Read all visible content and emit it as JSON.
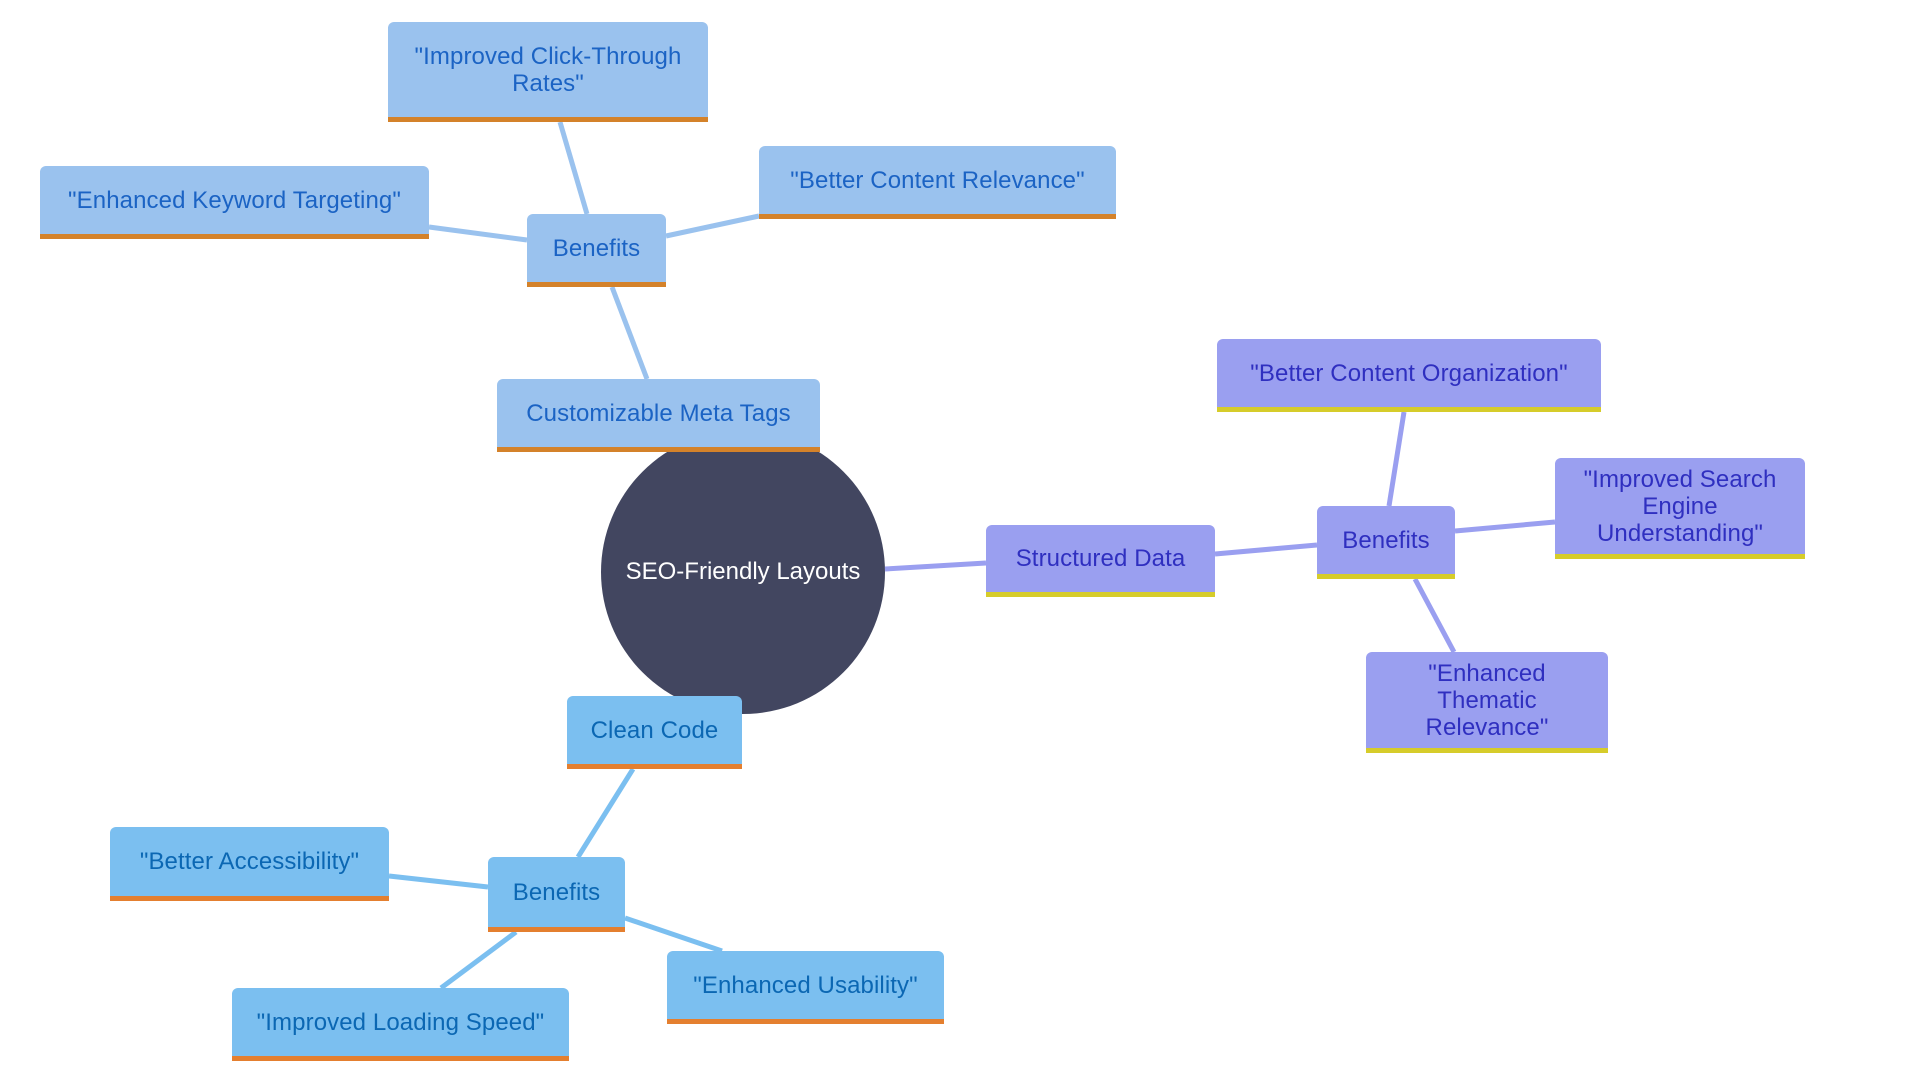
{
  "diagram": {
    "type": "mindmap",
    "root": {
      "id": "root",
      "label": "SEO-Friendly Layouts"
    },
    "colors": {
      "root_fill": "#424660",
      "root_text": "#ffffff",
      "branch_meta": {
        "fill": "#9ac2ee",
        "text": "#1b63c4",
        "underline": "#d4822a",
        "edge": "#9ac2ee"
      },
      "branch_structured": {
        "fill": "#9a9ff0",
        "text": "#2f2fc0",
        "underline": "#d6cc2a",
        "edge": "#9a9ff0"
      },
      "branch_clean": {
        "fill": "#7bbff0",
        "text": "#0b67b3",
        "underline": "#e47f2f",
        "edge": "#7bbff0"
      }
    },
    "nodes": [
      {
        "id": "meta",
        "label": "Customizable Meta Tags",
        "parent": "root",
        "branch": "top"
      },
      {
        "id": "meta-benefits",
        "label": "Benefits",
        "parent": "meta",
        "branch": "top"
      },
      {
        "id": "meta-b1",
        "label": "\"Improved Click-Through Rates\"",
        "lines": [
          "\"Improved Click-Through",
          "Rates\""
        ],
        "parent": "meta-benefits",
        "branch": "top"
      },
      {
        "id": "meta-b2",
        "label": "\"Enhanced Keyword Targeting\"",
        "lines": [
          "\"Enhanced Keyword Targeting\""
        ],
        "parent": "meta-benefits",
        "branch": "top"
      },
      {
        "id": "meta-b3",
        "label": "\"Better Content Relevance\"",
        "lines": [
          "\"Better Content Relevance\""
        ],
        "parent": "meta-benefits",
        "branch": "top"
      },
      {
        "id": "struct",
        "label": "Structured Data",
        "parent": "root",
        "branch": "right"
      },
      {
        "id": "struct-benefits",
        "label": "Benefits",
        "parent": "struct",
        "branch": "right"
      },
      {
        "id": "struct-b1",
        "label": "\"Better Content Organization\"",
        "lines": [
          "\"Better Content Organization\""
        ],
        "parent": "struct-benefits",
        "branch": "right"
      },
      {
        "id": "struct-b2",
        "label": "\"Improved Search Engine Understanding\"",
        "lines": [
          "\"Improved Search Engine",
          "Understanding\""
        ],
        "parent": "struct-benefits",
        "branch": "right"
      },
      {
        "id": "struct-b3",
        "label": "\"Enhanced Thematic Relevance\"",
        "lines": [
          "\"Enhanced Thematic",
          "Relevance\""
        ],
        "parent": "struct-benefits",
        "branch": "right"
      },
      {
        "id": "clean",
        "label": "Clean Code",
        "parent": "root",
        "branch": "bottom"
      },
      {
        "id": "clean-benefits",
        "label": "Benefits",
        "parent": "clean",
        "branch": "bottom"
      },
      {
        "id": "clean-b1",
        "label": "\"Better Accessibility\"",
        "lines": [
          "\"Better Accessibility\""
        ],
        "parent": "clean-benefits",
        "branch": "bottom"
      },
      {
        "id": "clean-b2",
        "label": "\"Improved Loading Speed\"",
        "lines": [
          "\"Improved Loading Speed\""
        ],
        "parent": "clean-benefits",
        "branch": "bottom"
      },
      {
        "id": "clean-b3",
        "label": "\"Enhanced Usability\"",
        "lines": [
          "\"Enhanced Usability\""
        ],
        "parent": "clean-benefits",
        "branch": "bottom"
      }
    ]
  }
}
